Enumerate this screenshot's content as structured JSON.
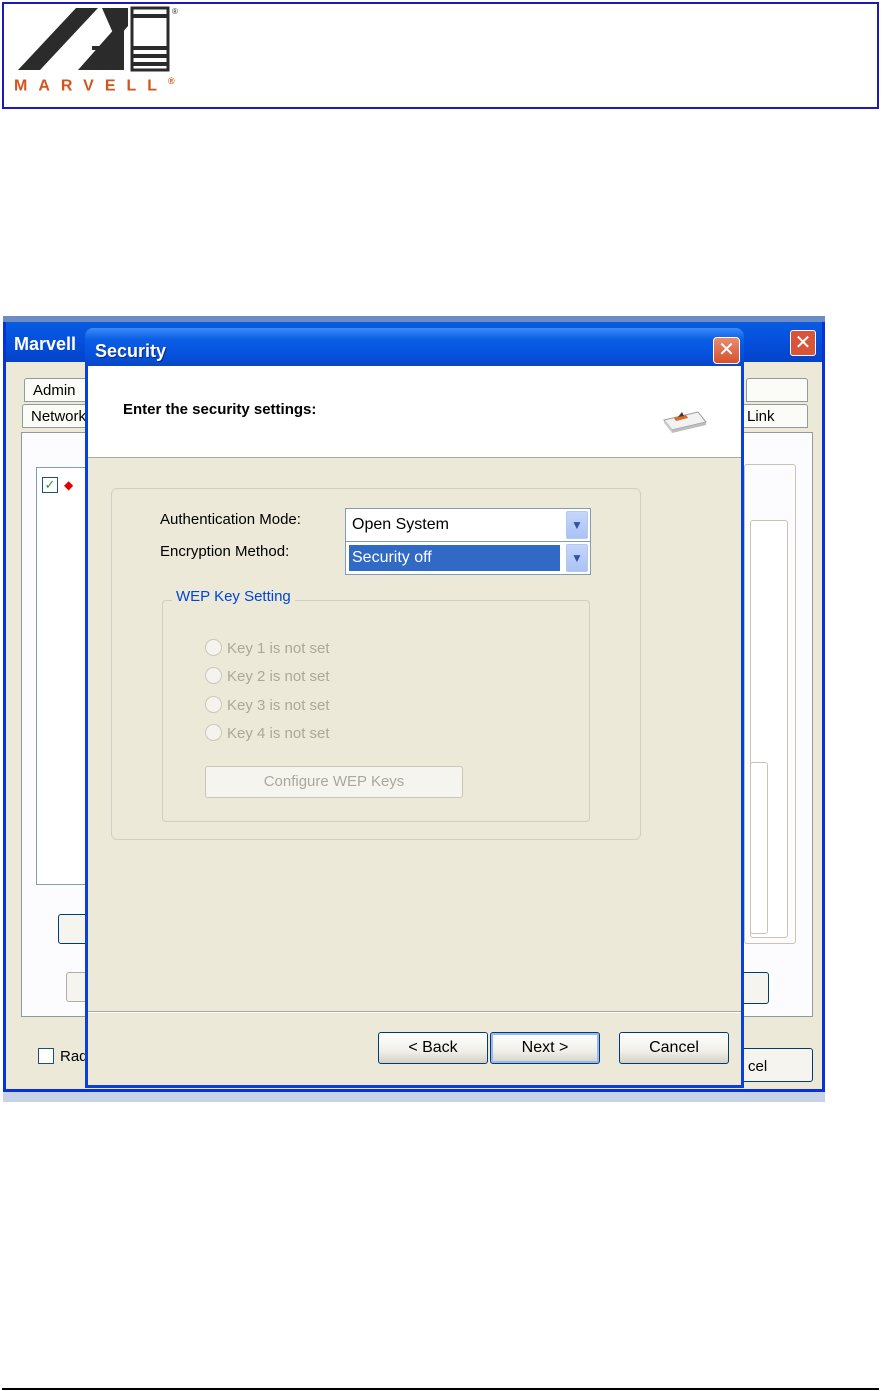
{
  "brand": {
    "wordmark": "MARVELL",
    "reg_mark": "®"
  },
  "background_window": {
    "title": "Marvell",
    "tabs": [
      "Admin",
      "Network",
      "Link"
    ],
    "bottom_checkbox_label": "Rad",
    "bottom_button_label": "cel"
  },
  "dialog": {
    "title": "Security",
    "heading": "Enter the security settings:",
    "auth_label": "Authentication Mode:",
    "auth_value": "Open System",
    "enc_label": "Encryption Method:",
    "enc_value": "Security off",
    "wep_group_label": "WEP Key Setting",
    "keys": [
      "Key 1 is not set",
      "Key 2 is not set",
      "Key 3 is not set",
      "Key 4 is not set"
    ],
    "configure_button": "Configure WEP Keys",
    "back_button": "< Back",
    "next_button": "Next >",
    "cancel_button": "Cancel"
  },
  "icons": {
    "close": "close-icon",
    "dropdown": "chevron-down-icon",
    "checkbox": "checkmark-icon",
    "card": "wireless-card-icon"
  }
}
